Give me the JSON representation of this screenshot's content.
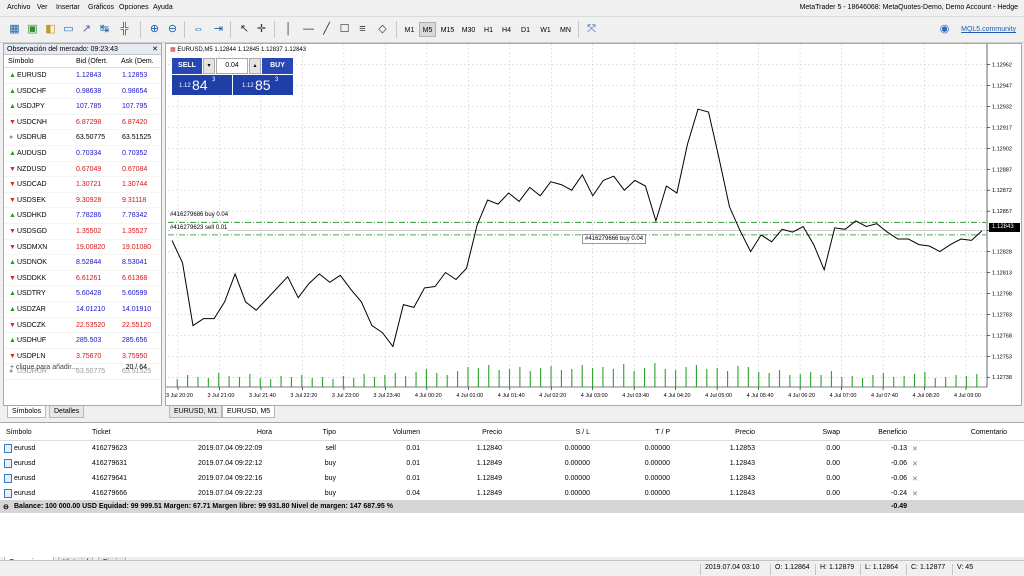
{
  "menu": {
    "items": [
      "Archivo",
      "Ver",
      "Insertar",
      "Gráficos",
      "Opciones",
      "Ayuda"
    ],
    "window_title": "MetaTrader 5 - 18646068: MetaQuotes-Demo, Demo Account - Hedge"
  },
  "toolbar": {
    "timeframes": [
      "M1",
      "M5",
      "M15",
      "M30",
      "H1",
      "H4",
      "D1",
      "W1",
      "MN"
    ],
    "active_timeframe": "M5",
    "mql_link": "MQL5.community"
  },
  "market_watch": {
    "title": "Observación del mercado: 09:23:43",
    "col_symbol": "Símbolo",
    "col_bid": "Bid (Ofert.",
    "col_ask": "Ask (Dem.",
    "rows": [
      {
        "symbol": "EURUSD",
        "bid": "1.12843",
        "ask": "1.12853",
        "dir": "up",
        "color": "blue"
      },
      {
        "symbol": "USDCHF",
        "bid": "0.98638",
        "ask": "0.98654",
        "dir": "up",
        "color": "blue"
      },
      {
        "symbol": "USDJPY",
        "bid": "107.785",
        "ask": "107.795",
        "dir": "up",
        "color": "blue"
      },
      {
        "symbol": "USDCNH",
        "bid": "6.87298",
        "ask": "6.87420",
        "dir": "dn",
        "color": "red"
      },
      {
        "symbol": "USDRUB",
        "bid": "63.50775",
        "ask": "63.51525",
        "dir": "nc",
        "color": "black"
      },
      {
        "symbol": "AUDUSD",
        "bid": "0.70334",
        "ask": "0.70352",
        "dir": "up",
        "color": "blue"
      },
      {
        "symbol": "NZDUSD",
        "bid": "0.67049",
        "ask": "0.67084",
        "dir": "dn",
        "color": "red"
      },
      {
        "symbol": "USDCAD",
        "bid": "1.30721",
        "ask": "1.30744",
        "dir": "dn",
        "color": "red"
      },
      {
        "symbol": "USDSEK",
        "bid": "9.30928",
        "ask": "9.31118",
        "dir": "dn",
        "color": "red"
      },
      {
        "symbol": "USDHKD",
        "bid": "7.78286",
        "ask": "7.78342",
        "dir": "up",
        "color": "blue"
      },
      {
        "symbol": "USDSGD",
        "bid": "1.35502",
        "ask": "1.35527",
        "dir": "dn",
        "color": "red"
      },
      {
        "symbol": "USDMXN",
        "bid": "19.00820",
        "ask": "19.01080",
        "dir": "dn",
        "color": "red"
      },
      {
        "symbol": "USDNOK",
        "bid": "8.52844",
        "ask": "8.53041",
        "dir": "up",
        "color": "blue"
      },
      {
        "symbol": "USDDKK",
        "bid": "6.61261",
        "ask": "6.61368",
        "dir": "dn",
        "color": "red"
      },
      {
        "symbol": "USDTRY",
        "bid": "5.60428",
        "ask": "5.60599",
        "dir": "up",
        "color": "blue"
      },
      {
        "symbol": "USDZAR",
        "bid": "14.01210",
        "ask": "14.01910",
        "dir": "up",
        "color": "blue"
      },
      {
        "symbol": "USDCZK",
        "bid": "22.53520",
        "ask": "22.55120",
        "dir": "dn",
        "color": "red"
      },
      {
        "symbol": "USDHUF",
        "bid": "285.503",
        "ask": "285.656",
        "dir": "up",
        "color": "blue"
      },
      {
        "symbol": "USDPLN",
        "bid": "3.75670",
        "ask": "3.75950",
        "dir": "dn",
        "color": "red"
      },
      {
        "symbol": "USDRUR",
        "bid": "63.50775",
        "ask": "63.51525",
        "dir": "nc",
        "color": "grey"
      }
    ],
    "add_label": "clique para añadir...",
    "count": "20 / 64"
  },
  "mw_tabs": [
    "Símbolos",
    "Detalles"
  ],
  "chart": {
    "header": "EURUSD,M5  1.12844 1.12845 1.12837 1.12843",
    "one_click": {
      "sell": "SELL",
      "buy": "BUY",
      "lot": "0.04",
      "sell_prefix": "1.12",
      "sell_big": "84",
      "sell_sup": "3",
      "buy_prefix": "1.12",
      "buy_big": "85",
      "buy_sup": "3"
    },
    "price_labels": [
      "1.12962",
      "1.12947",
      "1.12932",
      "1.12917",
      "1.12902",
      "1.12887",
      "1.12872",
      "1.12857",
      "1.12843",
      "1.12828",
      "1.12813",
      "1.12798",
      "1.12783",
      "1.12768",
      "1.12753",
      "1.12738"
    ],
    "current_price": "1.12843",
    "time_labels": [
      "3 Jul 20:20",
      "3 Jul 21:00",
      "3 Jul 21:40",
      "3 Jul 22:20",
      "3 Jul 23:00",
      "3 Jul 23:40",
      "4 Jul 00:20",
      "4 Jul 01:00",
      "4 Jul 01:40",
      "4 Jul 02:20",
      "4 Jul 03:00",
      "4 Jul 03:40",
      "4 Jul 04:20",
      "4 Jul 05:00",
      "4 Jul 05:40",
      "4 Jul 06:20",
      "4 Jul 07:00",
      "4 Jul 07:40",
      "4 Jul 08:20",
      "4 Jul 09:00"
    ],
    "order_lines": [
      {
        "label": "#416279686 buy 0.04",
        "price": "1.12849"
      },
      {
        "label": "#416279623 sell 0.01",
        "price": "1.12840"
      }
    ],
    "tooltip": "#416279666 buy 0.04"
  },
  "chart_tabs": [
    "EURUSD, M1",
    "EURUSD, M5"
  ],
  "trade": {
    "headers": [
      "Símbolo",
      "Ticket",
      "Hora",
      "Tipo",
      "Volumen",
      "Precio",
      "S / L",
      "T / P",
      "Precio",
      "Swap",
      "Beneficio",
      "Comentario"
    ],
    "rows": [
      [
        "eurusd",
        "416279623",
        "2019.07.04 09:22:09",
        "sell",
        "0.01",
        "1.12840",
        "0.00000",
        "0.00000",
        "1.12853",
        "0.00",
        "-0.13"
      ],
      [
        "eurusd",
        "416279631",
        "2019.07.04 09:22:12",
        "buy",
        "0.01",
        "1.12849",
        "0.00000",
        "0.00000",
        "1.12843",
        "0.00",
        "-0.06"
      ],
      [
        "eurusd",
        "416279641",
        "2019.07.04 09:22:16",
        "buy",
        "0.01",
        "1.12849",
        "0.00000",
        "0.00000",
        "1.12843",
        "0.00",
        "-0.06"
      ],
      [
        "eurusd",
        "416279666",
        "2019.07.04 09:22:23",
        "buy",
        "0.04",
        "1.12849",
        "0.00000",
        "0.00000",
        "1.12843",
        "0.00",
        "-0.24"
      ]
    ],
    "balance": "Balance: 100 000.00 USD  Equidad: 99 999.51  Margen: 67.71  Margen libre: 99 931.80  Nivel de margen: 147 687.95 %",
    "balance_profit": "-0.49"
  },
  "bottom_tabs": [
    "Operaciones",
    "Historial",
    "Diario"
  ],
  "status": {
    "datetime": "2019.07.04 03:10",
    "open": "O: 1.12864",
    "high": "H: 1.12879",
    "low": "L: 1.12864",
    "close": "C: 1.12877",
    "volume": "V: 45"
  },
  "chart_data": {
    "type": "line",
    "y_range": [
      1.12731,
      1.12971
    ],
    "close": [
      1.12836,
      1.1282,
      1.12775,
      1.1278,
      1.1278,
      1.12792,
      1.12812,
      1.12792,
      1.12786,
      1.12794,
      1.12802,
      1.1281,
      1.12795,
      1.12805,
      1.12812,
      1.12806,
      1.12811,
      1.12801,
      1.12792,
      1.12775,
      1.1277,
      1.1276,
      1.1279,
      1.12788,
      1.12802,
      1.12803,
      1.12813,
      1.12808,
      1.12816,
      1.12847,
      1.12865,
      1.12862,
      1.1287,
      1.12864,
      1.12874,
      1.12868,
      1.12878,
      1.12876,
      1.12872,
      1.12883,
      1.12868,
      1.12879,
      1.12882,
      1.12872,
      1.12879,
      1.12875,
      1.1285,
      1.12875,
      1.1287,
      1.12905,
      1.1293,
      1.12928,
      1.12895,
      1.1286,
      1.12843,
      1.12828,
      1.1284,
      1.12835,
      1.12844,
      1.12842,
      1.12846,
      1.12833,
      1.12815,
      1.12845,
      1.12844,
      1.1285,
      1.12846,
      1.12848,
      1.12842,
      1.12837,
      1.12837,
      1.12833,
      1.12832,
      1.12828,
      1.12833,
      1.12837,
      1.12836,
      1.12843
    ],
    "volume": [
      8,
      12,
      10,
      9,
      14,
      11,
      10,
      13,
      9,
      8,
      11,
      10,
      12,
      9,
      10,
      8,
      11,
      9,
      13,
      10,
      12,
      14,
      11,
      15,
      18,
      14,
      12,
      16,
      20,
      19,
      22,
      17,
      18,
      20,
      16,
      19,
      21,
      17,
      18,
      22,
      19,
      20,
      18,
      23,
      16,
      19,
      24,
      18,
      17,
      20,
      22,
      18,
      19,
      16,
      21,
      20,
      15,
      14,
      17,
      12,
      13,
      15,
      12,
      16,
      10,
      11,
      9,
      12,
      14,
      10,
      11,
      13,
      15,
      9,
      10,
      12,
      11,
      13
    ],
    "volume_max": 30
  }
}
